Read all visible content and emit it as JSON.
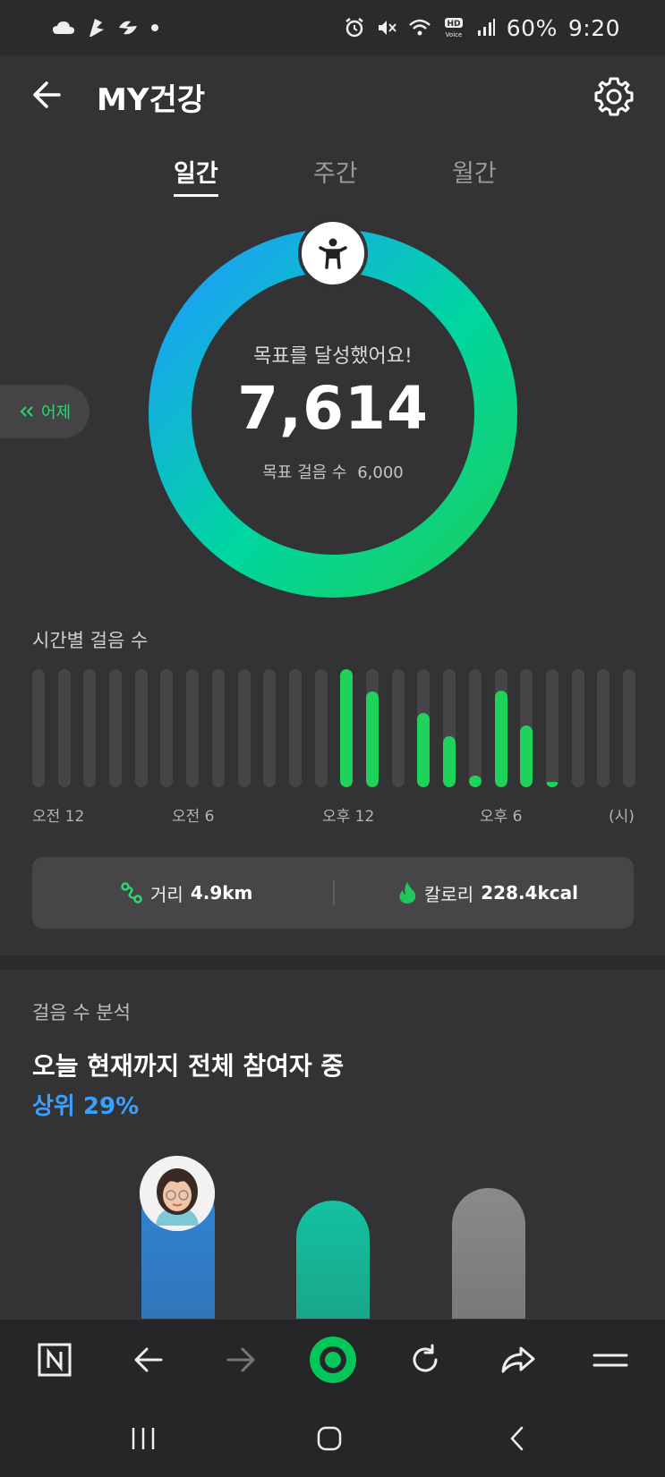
{
  "status_bar": {
    "battery": "60%",
    "time": "9:20",
    "left_icons": [
      "cloud-icon",
      "app-icon",
      "app-icon",
      "dot-icon"
    ],
    "right_icons": [
      "alarm-icon",
      "mute-icon",
      "wifi-icon",
      "hd-voice-icon",
      "signal-icon"
    ]
  },
  "header": {
    "title": "MY건강"
  },
  "tabs": [
    {
      "label": "일간",
      "active": true
    },
    {
      "label": "주간",
      "active": false
    },
    {
      "label": "월간",
      "active": false
    }
  ],
  "ring": {
    "message": "목표를 달성했어요!",
    "steps": "7,614",
    "goal_label": "목표 걸음 수",
    "goal_value": "6,000",
    "progress_fraction": 1.0,
    "colors": {
      "start": "#1e9bff",
      "mid": "#00d6a0",
      "end": "#18cf62"
    }
  },
  "yesterday_button": {
    "label": "어제"
  },
  "hourly": {
    "title": "시간별 걸음 수",
    "axis_labels": [
      "오전 12",
      "오전 6",
      "오후 12",
      "오후 6",
      "(시)"
    ],
    "fill_fractions": [
      0,
      0,
      0,
      0,
      0,
      0,
      0,
      0,
      0,
      0,
      0,
      0,
      1.0,
      0.81,
      0,
      0.63,
      0.43,
      0.1,
      0.82,
      0.52,
      0.01,
      0,
      0,
      0
    ],
    "active_color": "#1ed25a"
  },
  "stats": {
    "distance_label": "거리",
    "distance_value": "4.9km",
    "calorie_label": "칼로리",
    "calorie_value": "228.4kcal"
  },
  "analysis": {
    "label": "걸음 수 분석",
    "headline": "오늘 현재까지 전체 참여자 중",
    "rank": "상위 29%",
    "colors": [
      "#2f86d9",
      "#13c2a0",
      "#8a8a8c"
    ]
  },
  "browser_bar": {
    "icons": [
      "naver-n-icon",
      "back-arrow-icon",
      "forward-arrow-icon",
      "home-circle-icon",
      "refresh-icon",
      "share-icon",
      "menu-icon"
    ],
    "brand_color": "#03c75a"
  },
  "system_nav": {
    "icons": [
      "recent-apps-icon",
      "home-icon",
      "back-icon"
    ]
  }
}
